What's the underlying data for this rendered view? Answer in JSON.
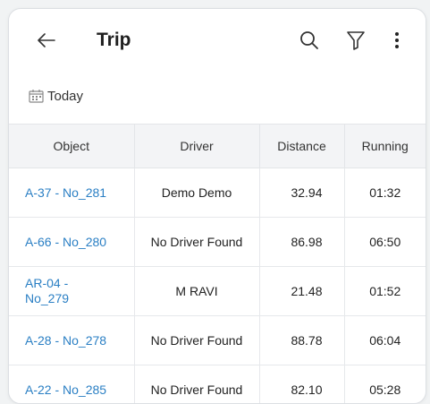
{
  "header": {
    "title": "Trip"
  },
  "filter": {
    "date_label": "Today"
  },
  "table": {
    "columns": [
      "Object",
      "Driver",
      "Distance",
      "Running"
    ],
    "rows": [
      {
        "object": "A-37 - No_281",
        "driver": "Demo Demo",
        "distance": "32.94",
        "running": "01:32"
      },
      {
        "object": "A-66 - No_280",
        "driver": "No Driver Found",
        "distance": "86.98",
        "running": "06:50"
      },
      {
        "object": "AR-04 - No_279",
        "driver": "M RAVI",
        "distance": "21.48",
        "running": "01:52"
      },
      {
        "object": "A-28 - No_278",
        "driver": "No Driver Found",
        "distance": "88.78",
        "running": "06:04"
      },
      {
        "object": "A-22 - No_285",
        "driver": "No Driver Found",
        "distance": "82.10",
        "running": "05:28"
      }
    ]
  },
  "icons": {
    "back": "arrow-left-icon",
    "search": "search-icon",
    "filter": "filter-icon",
    "more": "more-vert-icon",
    "calendar": "calendar-icon"
  },
  "colors": {
    "link": "#2a7fc4",
    "header_bg": "#f3f4f6",
    "card_bg": "#ffffff",
    "page_bg": "#f1f3f4"
  }
}
